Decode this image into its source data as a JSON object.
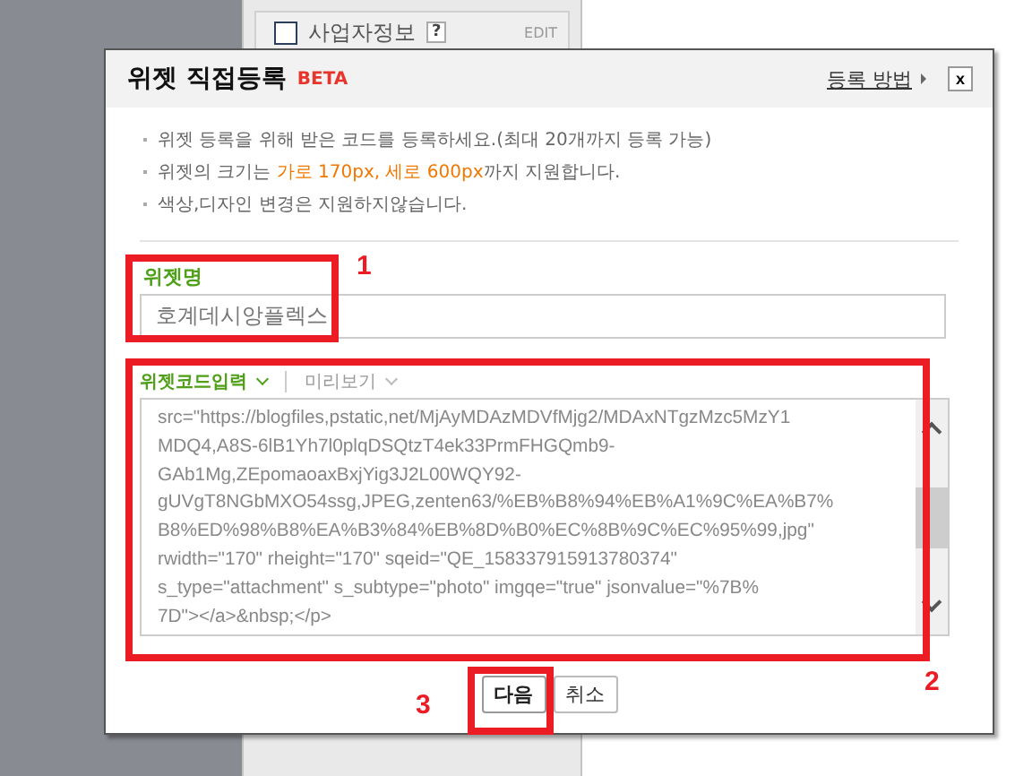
{
  "background_panel": {
    "item": {
      "label": "사업자정보",
      "checked": false,
      "help": "?",
      "edit": "EDIT"
    }
  },
  "dialog": {
    "title": "위젯 직접등록",
    "badge": "BETA",
    "help_link": "등록 방법",
    "close": "x",
    "notes": [
      {
        "before": "위젯 등록을 위해 받은 코드를 등록하세요.(최대 20개까지 등록 가능)"
      },
      {
        "before": "위젯의 크기는 ",
        "highlight": "가로 170px, 세로 600px",
        "after": "까지 지원합니다."
      },
      {
        "before": "색상,디자인 변경은 지원하지않습니다."
      }
    ],
    "name_field": {
      "label": "위젯명",
      "value": "호계데시앙플렉스"
    },
    "tabs": [
      {
        "label": "위젯코드입력",
        "selected": true
      },
      {
        "label": "미리보기",
        "selected": false
      }
    ],
    "code_lines": [
      "src=\"https://blogfiles,pstatic,net/MjAyMDAzMDVfMjg2/MDAxNTgzMzc5MzY1",
      "MDQ4,A8S-6lB1Yh7l0plqDSQtzT4ek33PrmFHGQmb9-",
      "GAb1Mg,ZEpomaoaxBxjYig3J2L00WQY92-",
      "gUVgT8NGbMXO54ssg,JPEG,zenten63/%EB%B8%94%EB%A1%9C%EA%B7%",
      "B8%ED%98%B8%EA%B3%84%EB%8D%B0%EC%8B%9C%EC%95%99,jpg\"",
      "rwidth=\"170\" rheight=\"170\" sqeid=\"QE_158337915913780374\"",
      "s_type=\"attachment\" s_subtype=\"photo\" imgqe=\"true\" jsonvalue=\"%7B%",
      "7D\"></a>&nbsp;</p>"
    ],
    "buttons": [
      {
        "label": "다음",
        "primary": true
      },
      {
        "label": "취소",
        "primary": false
      }
    ]
  },
  "annotations": [
    {
      "number": "1"
    },
    {
      "number": "2"
    },
    {
      "number": "3"
    }
  ]
}
